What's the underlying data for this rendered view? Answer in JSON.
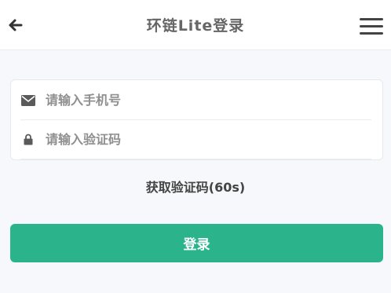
{
  "header": {
    "title": "环链Lite登录",
    "back_icon": "arrow-left-icon",
    "menu_icon": "hamburger-menu-icon"
  },
  "form": {
    "phone_placeholder": "请输入手机号",
    "phone_value": "",
    "phone_icon": "envelope-icon",
    "code_placeholder": "请输入验证码",
    "code_value": "",
    "code_icon": "lock-icon"
  },
  "get_code_label": "获取验证码(60s)",
  "login_button_label": "登录",
  "colors": {
    "accent": "#2bb38b",
    "background": "#f6f8fb"
  }
}
